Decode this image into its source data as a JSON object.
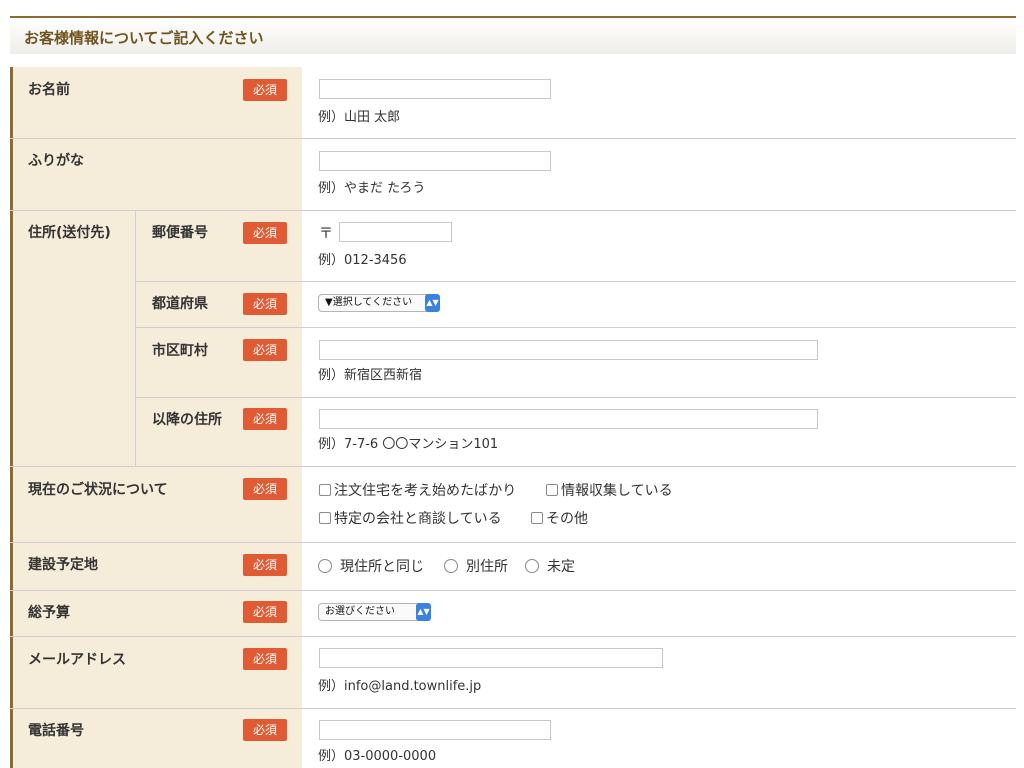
{
  "header": {
    "title": "お客様情報についてご記入ください"
  },
  "required_label": "必須",
  "fields": {
    "name": {
      "label": "お名前",
      "example": "例）山田 太郎"
    },
    "furigana": {
      "label": "ふりがな",
      "example": "例）やまだ たろう"
    },
    "address": {
      "label": "住所(送付先)",
      "postal": {
        "label": "郵便番号",
        "prefix": "〒",
        "example": "例）012-3456"
      },
      "prefecture": {
        "label": "都道府県",
        "selected": "▼選択してください"
      },
      "city": {
        "label": "市区町村",
        "example": "例）新宿区西新宿"
      },
      "street": {
        "label": "以降の住所",
        "example": "例）7-7-6 〇〇マンション101"
      }
    },
    "status": {
      "label": "現在のご状況について",
      "options": [
        "注文住宅を考え始めたばかり",
        "情報収集している",
        "特定の会社と商談している",
        "その他"
      ]
    },
    "site": {
      "label": "建設予定地",
      "options": [
        "現住所と同じ",
        "別住所",
        "未定"
      ]
    },
    "budget": {
      "label": "総予算",
      "selected": "お選びください"
    },
    "email": {
      "label": "メールアドレス",
      "example": "例）info@land.townlife.jp"
    },
    "phone": {
      "label": "電話番号",
      "example": "例）03-0000-0000"
    }
  }
}
